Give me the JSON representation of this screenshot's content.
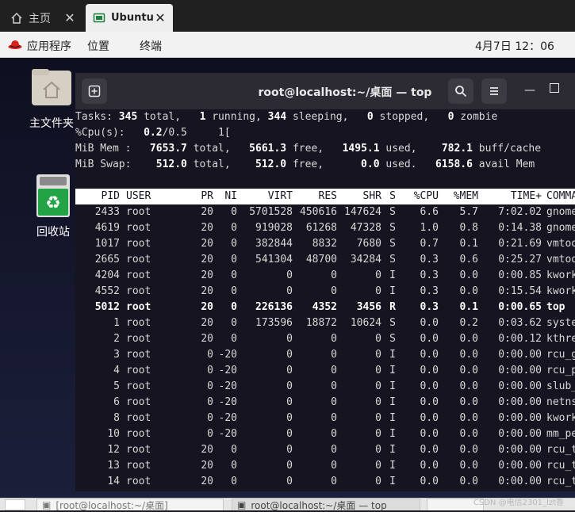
{
  "vm_tabs": [
    {
      "label": "主页",
      "icon": "home-icon"
    },
    {
      "label": "Ubuntu",
      "icon": "vm-icon"
    }
  ],
  "panel": {
    "applications": "应用程序",
    "places": "位置",
    "terminal": "终端",
    "clock": "4月7日  12：06"
  },
  "desktop": {
    "home_folder": "主文件夹",
    "trash": "回收站"
  },
  "terminal": {
    "title": "root@localhost:~/桌面 — top"
  },
  "summary": [
    [
      [
        "Tasks: ",
        0
      ],
      [
        "345",
        1
      ],
      [
        " total,   ",
        0
      ],
      [
        "1",
        1
      ],
      [
        " running, ",
        0
      ],
      [
        "344",
        1
      ],
      [
        " sleeping,   ",
        0
      ],
      [
        "0",
        1
      ],
      [
        " stopped,   ",
        0
      ],
      [
        "0",
        1
      ],
      [
        " zombie",
        0
      ]
    ],
    [
      [
        "%Cpu(s):   ",
        0
      ],
      [
        "0.2",
        1
      ],
      [
        "/0.5     1[",
        0
      ]
    ],
    [
      [
        "MiB Mem :   ",
        0
      ],
      [
        "7653.7",
        1
      ],
      [
        " total,   ",
        0
      ],
      [
        "5661.3",
        1
      ],
      [
        " free,   ",
        0
      ],
      [
        "1495.1",
        1
      ],
      [
        " used,    ",
        0
      ],
      [
        "782.1",
        1
      ],
      [
        " buff/cache",
        0
      ]
    ],
    [
      [
        "MiB Swap:    ",
        0
      ],
      [
        "512.0",
        1
      ],
      [
        " total,    ",
        0
      ],
      [
        "512.0",
        1
      ],
      [
        " free,      ",
        0
      ],
      [
        "0.0",
        1
      ],
      [
        " used.   ",
        0
      ],
      [
        "6158.6",
        1
      ],
      [
        " avail Mem",
        0
      ]
    ]
  ],
  "columns": [
    "PID",
    "USER",
    "PR",
    "NI",
    "VIRT",
    "RES",
    "SHR",
    "S",
    "%CPU",
    "%MEM",
    "TIME+",
    "COMMAND"
  ],
  "processes": [
    [
      "2433",
      "root",
      "20",
      "0",
      "5701528",
      "450616",
      "147624",
      "S",
      "6.6",
      "5.7",
      "7:02.02",
      "gnome-sh"
    ],
    [
      "4619",
      "root",
      "20",
      "0",
      "919028",
      "61268",
      "47328",
      "S",
      "1.0",
      "0.8",
      "0:14.38",
      "gnome-te"
    ],
    [
      "1017",
      "root",
      "20",
      "0",
      "382844",
      "8832",
      "7680",
      "S",
      "0.7",
      "0.1",
      "0:21.69",
      "vmtoolsd"
    ],
    [
      "2665",
      "root",
      "20",
      "0",
      "541304",
      "48700",
      "34284",
      "S",
      "0.3",
      "0.6",
      "0:25.27",
      "vmtoolsd"
    ],
    [
      "4204",
      "root",
      "20",
      "0",
      "0",
      "0",
      "0",
      "I",
      "0.3",
      "0.0",
      "0:00.85",
      "kworker/"
    ],
    [
      "4552",
      "root",
      "20",
      "0",
      "0",
      "0",
      "0",
      "I",
      "0.3",
      "0.0",
      "0:15.54",
      "kworker/"
    ],
    [
      "5012",
      "root",
      "20",
      "0",
      "226136",
      "4352",
      "3456",
      "R",
      "0.3",
      "0.1",
      "0:00.65",
      "top"
    ],
    [
      "1",
      "root",
      "20",
      "0",
      "173596",
      "18872",
      "10624",
      "S",
      "0.0",
      "0.2",
      "0:03.62",
      "systemd"
    ],
    [
      "2",
      "root",
      "20",
      "0",
      "0",
      "0",
      "0",
      "S",
      "0.0",
      "0.0",
      "0:00.12",
      "kthreadd"
    ],
    [
      "3",
      "root",
      "0",
      "-20",
      "0",
      "0",
      "0",
      "I",
      "0.0",
      "0.0",
      "0:00.00",
      "rcu_gp"
    ],
    [
      "4",
      "root",
      "0",
      "-20",
      "0",
      "0",
      "0",
      "I",
      "0.0",
      "0.0",
      "0:00.00",
      "rcu_par_"
    ],
    [
      "5",
      "root",
      "0",
      "-20",
      "0",
      "0",
      "0",
      "I",
      "0.0",
      "0.0",
      "0:00.00",
      "slub_flu"
    ],
    [
      "6",
      "root",
      "0",
      "-20",
      "0",
      "0",
      "0",
      "I",
      "0.0",
      "0.0",
      "0:00.00",
      "netns"
    ],
    [
      "8",
      "root",
      "0",
      "-20",
      "0",
      "0",
      "0",
      "I",
      "0.0",
      "0.0",
      "0:00.00",
      "kworker/"
    ],
    [
      "10",
      "root",
      "0",
      "-20",
      "0",
      "0",
      "0",
      "I",
      "0.0",
      "0.0",
      "0:00.00",
      "mm_percp"
    ],
    [
      "12",
      "root",
      "20",
      "0",
      "0",
      "0",
      "0",
      "I",
      "0.0",
      "0.0",
      "0:00.00",
      "rcu_task"
    ],
    [
      "13",
      "root",
      "20",
      "0",
      "0",
      "0",
      "0",
      "I",
      "0.0",
      "0.0",
      "0:00.00",
      "rcu_task"
    ],
    [
      "14",
      "root",
      "20",
      "0",
      "0",
      "0",
      "0",
      "I",
      "0.0",
      "0.0",
      "0:00.00",
      "rcu_task"
    ]
  ],
  "highlight_pid": "5012",
  "taskbar": [
    {
      "label": "[root@localhost:~/桌面]"
    },
    {
      "label": "root@localhost:~/桌面 — top"
    }
  ],
  "watermark": "CSDN @电信2301_lzt香",
  "colors": {
    "terminal_bg": "#171421",
    "panel_bg": "#f2f2f2",
    "hat": "#d9211d"
  }
}
